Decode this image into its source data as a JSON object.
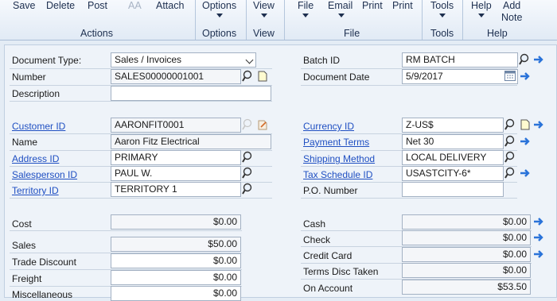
{
  "ribbon": {
    "save": "Save",
    "delete": "Delete",
    "post": "Post",
    "aa": "AA",
    "attach": "Attach",
    "actions_group": "Actions",
    "options": "Options",
    "options_group": "Options",
    "view": "View",
    "view_group": "View",
    "file": "File",
    "email": "Email",
    "print1": "Print",
    "print2": "Print",
    "file_group": "File",
    "tools": "Tools",
    "tools_group": "Tools",
    "help": "Help",
    "add_note_1": "Add",
    "add_note_2": "Note",
    "help_group": "Help"
  },
  "form": {
    "document_type_label": "Document Type:",
    "document_type_value": "Sales / Invoices",
    "number_label": "Number",
    "number_value": "SALES00000001001",
    "description_label": "Description",
    "description_value": "",
    "batch_id_label": "Batch ID",
    "batch_id_value": "RM BATCH",
    "document_date_label": "Document Date",
    "document_date_value": "5/9/2017",
    "customer_id_label": "Customer ID",
    "customer_id_value": "AARONFIT0001",
    "name_label": "Name",
    "name_value": "Aaron Fitz Electrical",
    "address_id_label": "Address ID",
    "address_id_value": "PRIMARY",
    "salesperson_id_label": "Salesperson ID",
    "salesperson_id_value": "PAUL W.",
    "territory_id_label": "Territory ID",
    "territory_id_value": "TERRITORY 1",
    "currency_id_label": "Currency ID",
    "currency_id_value": "Z-US$",
    "payment_terms_label": "Payment Terms",
    "payment_terms_value": "Net 30",
    "shipping_method_label": "Shipping Method",
    "shipping_method_value": "LOCAL DELIVERY",
    "tax_schedule_id_label": "Tax Schedule ID",
    "tax_schedule_id_value": "USASTCITY-6*",
    "po_number_label": "P.O. Number",
    "po_number_value": ""
  },
  "amounts": {
    "cost_label": "Cost",
    "cost_value": "$0.00",
    "sales_label": "Sales",
    "sales_value": "$50.00",
    "trade_discount_label": "Trade Discount",
    "trade_discount_value": "$0.00",
    "freight_label": "Freight",
    "freight_value": "$0.00",
    "miscellaneous_label": "Miscellaneous",
    "miscellaneous_value": "$0.00",
    "cash_label": "Cash",
    "cash_value": "$0.00",
    "check_label": "Check",
    "check_value": "$0.00",
    "credit_card_label": "Credit Card",
    "credit_card_value": "$0.00",
    "terms_disc_taken_label": "Terms Disc Taken",
    "terms_disc_taken_value": "$0.00",
    "on_account_label": "On Account",
    "on_account_value": "$53.50"
  },
  "colors": {
    "link": "#1f4fc2",
    "accent_arrow": "#2a73d9",
    "ribbon_bg": "#e9f0f8"
  }
}
